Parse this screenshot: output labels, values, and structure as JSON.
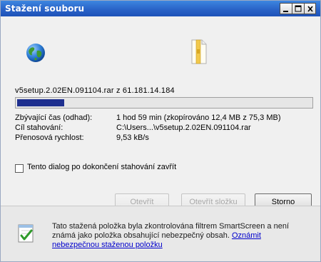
{
  "window": {
    "title": "Stažení souboru"
  },
  "download": {
    "filename_line": "v5setup.2.02EN.091104.rar z 61.181.14.184",
    "progress_fraction": 0.16
  },
  "info": {
    "time_label": "Zbývající čas (odhad):",
    "time_value": "1 hod 59 min (zkopírováno 12,4 MB z 75,3 MB)",
    "target_label": "Cíl stahování:",
    "target_value": "C:\\Users...\\v5setup.2.02EN.091104.rar",
    "speed_label": "Přenosová rychlost:",
    "speed_value": "9,53 kB/s"
  },
  "options": {
    "close_dialog_label": "Tento dialog po dokončení stahování zavřít",
    "close_dialog_checked": false
  },
  "buttons": {
    "open": "Otevřít",
    "open_folder": "Otevřít složku",
    "cancel": "Storno"
  },
  "footer": {
    "text": "Tato stažená položka byla zkontrolována filtrem SmartScreen a není známá jako položka obsahující nebezpečný obsah.",
    "link": "Oznámit nebezpečnou staženou položku"
  },
  "icons": {
    "globe": "globe-icon",
    "document": "document-icon",
    "shield": "smartscreen-shield-icon"
  }
}
